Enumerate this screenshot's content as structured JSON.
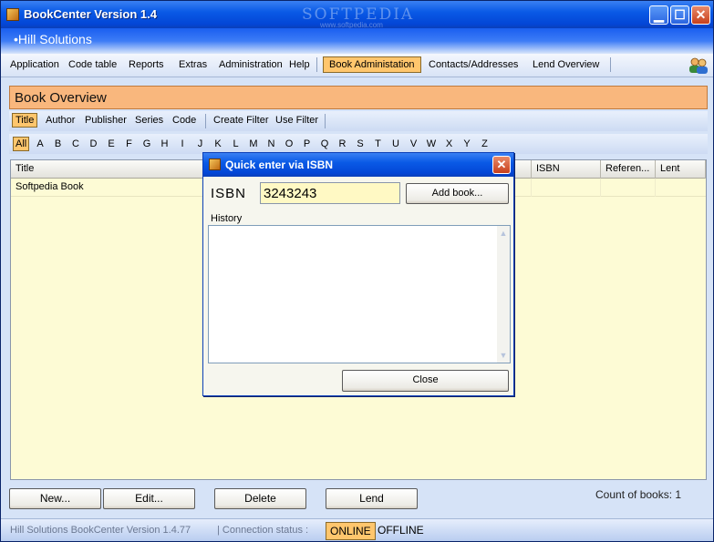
{
  "window": {
    "title": "BookCenter Version 1.4",
    "watermark": "SOFTPEDIA",
    "watermark_url": "www.softpedia.com",
    "minimize": "▁",
    "maximize": "☐",
    "close": "✕"
  },
  "brand": "•Hill Solutions",
  "menu": {
    "items": [
      "Application",
      "Code table",
      "Reports",
      "Extras",
      "Administration",
      "Help"
    ],
    "book_admin": "Book Administation",
    "contacts": "Contacts/Addresses",
    "lend_overview": "Lend Overview"
  },
  "panel": {
    "title": "Book Overview"
  },
  "filters": {
    "items": [
      "Title",
      "Author",
      "Publisher",
      "Series",
      "Code"
    ],
    "create_filter": "Create Filter",
    "use_filter": "Use Filter",
    "active": "Title"
  },
  "alphabet": [
    "All",
    "A",
    "B",
    "C",
    "D",
    "E",
    "F",
    "G",
    "H",
    "I",
    "J",
    "K",
    "L",
    "M",
    "N",
    "O",
    "P",
    "Q",
    "R",
    "S",
    "T",
    "U",
    "V",
    "W",
    "X",
    "Y",
    "Z"
  ],
  "table": {
    "columns": {
      "title": "Title",
      "isbn": "ISBN",
      "reference": "Referen...",
      "lent": "Lent"
    },
    "rows": [
      {
        "title": "Softpedia Book"
      }
    ]
  },
  "buttons": {
    "new": "New...",
    "edit": "Edit...",
    "delete": "Delete",
    "lend": "Lend"
  },
  "count": "Count of books: 1",
  "status": {
    "app_version": "Hill Solutions BookCenter Version 1.4.77",
    "connection_label": "| Connection status :",
    "online": "ONLINE",
    "offline": "OFFLINE"
  },
  "dialog": {
    "title": "Quick enter via ISBN",
    "isbn_label": "ISBN",
    "isbn_value": "3243243",
    "add_button": "Add book...",
    "history_label": "History",
    "close_button": "Close",
    "close_x": "✕"
  },
  "colors": {
    "accent_orange": "#ffc66d",
    "panel_orange": "#f9b77d",
    "title_blue": "#0a5ae6",
    "table_bg": "#fdfbd5"
  }
}
